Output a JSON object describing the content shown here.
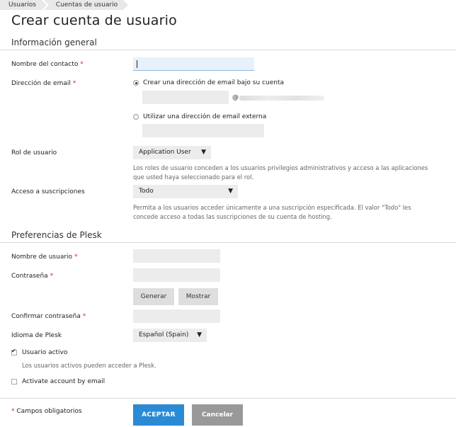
{
  "breadcrumb": [
    "Usuarios",
    "Cuentas de usuario"
  ],
  "page_title": "Crear cuenta de usuario",
  "general": {
    "title": "Información general",
    "contact_name": {
      "label": "Nombre del contacto",
      "value": ""
    },
    "email": {
      "label": "Dirección de email",
      "option_internal": "Crear una dirección de email bajo su cuenta",
      "at_sign": "@",
      "option_external": "Utilizar una dirección de email externa",
      "selected": "internal"
    },
    "role": {
      "label": "Rol de usuario",
      "selected": "Application User",
      "hint": "Los roles de usuario conceden a los usuarios privilegios administrativos y acceso a las aplicaciones que usted haya seleccionado para el rol."
    },
    "subscriptions": {
      "label": "Acceso a suscripciones",
      "selected": "Todo",
      "hint": "Permita a los usuarios acceder únicamente a una suscripción especificada. El valor \"Todo\" les concede acceso a todas las suscripciones de su cuenta de hosting."
    }
  },
  "plesk": {
    "title": "Preferencias de Plesk",
    "username": {
      "label": "Nombre de usuario",
      "value": ""
    },
    "password": {
      "label": "Contraseña",
      "value": ""
    },
    "generate_label": "Generar",
    "show_label": "Mostrar",
    "confirm_password": {
      "label": "Confirmar contraseña",
      "value": ""
    },
    "language": {
      "label": "Idioma de Plesk",
      "selected": "Español (Spain)"
    },
    "active_user": {
      "label": "Usuario activo",
      "checked": true,
      "hint": "Los usuarios activos pueden acceder a Plesk."
    },
    "activate_by_email": {
      "label": "Activate account by email",
      "checked": false
    }
  },
  "footer": {
    "required_note": "Campos obligatorios",
    "required_mark": "*",
    "ok_label": "ACEPTAR",
    "cancel_label": "Cancelar"
  },
  "colors": {
    "primary": "#2a8ad4",
    "required": "#dd2222",
    "cancel": "#999999"
  }
}
